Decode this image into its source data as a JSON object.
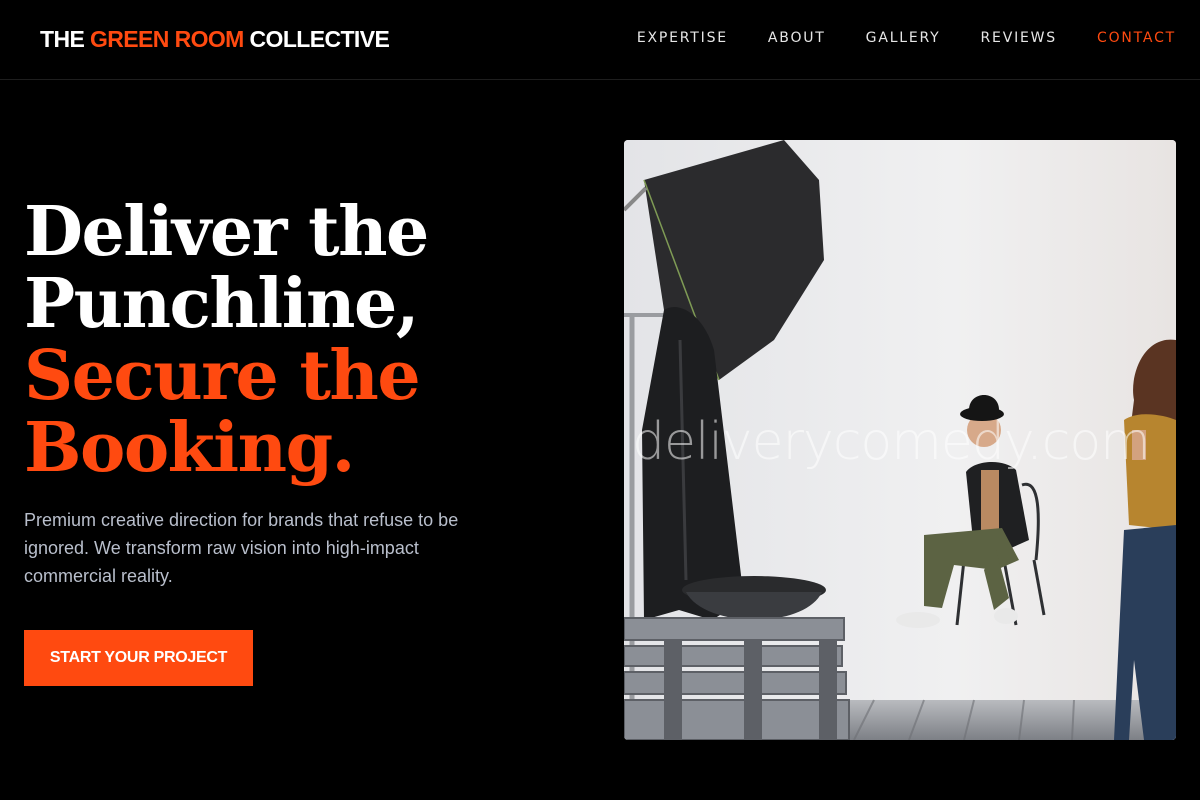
{
  "brand": {
    "prefix": "THE",
    "accent": "GREEN ROOM",
    "suffix": "COLLECTIVE",
    "accent_color": "#ff4a10"
  },
  "nav": {
    "items": [
      {
        "label": "EXPERTISE"
      },
      {
        "label": "ABOUT"
      },
      {
        "label": "GALLERY"
      },
      {
        "label": "REVIEWS"
      },
      {
        "label": "CONTACT",
        "active": true
      }
    ]
  },
  "hero": {
    "headline_white": [
      "Deliver the",
      "Punchline,"
    ],
    "headline_orange": [
      "Secure the",
      "Booking."
    ],
    "description": "Premium creative direction for brands that refuse to be ignored. We transform raw vision into high-impact commercial reality.",
    "cta_label": "START YOUR PROJECT"
  },
  "photo": {
    "watermark": "deliverycomedy.com",
    "subject": "photo-studio-scene"
  }
}
